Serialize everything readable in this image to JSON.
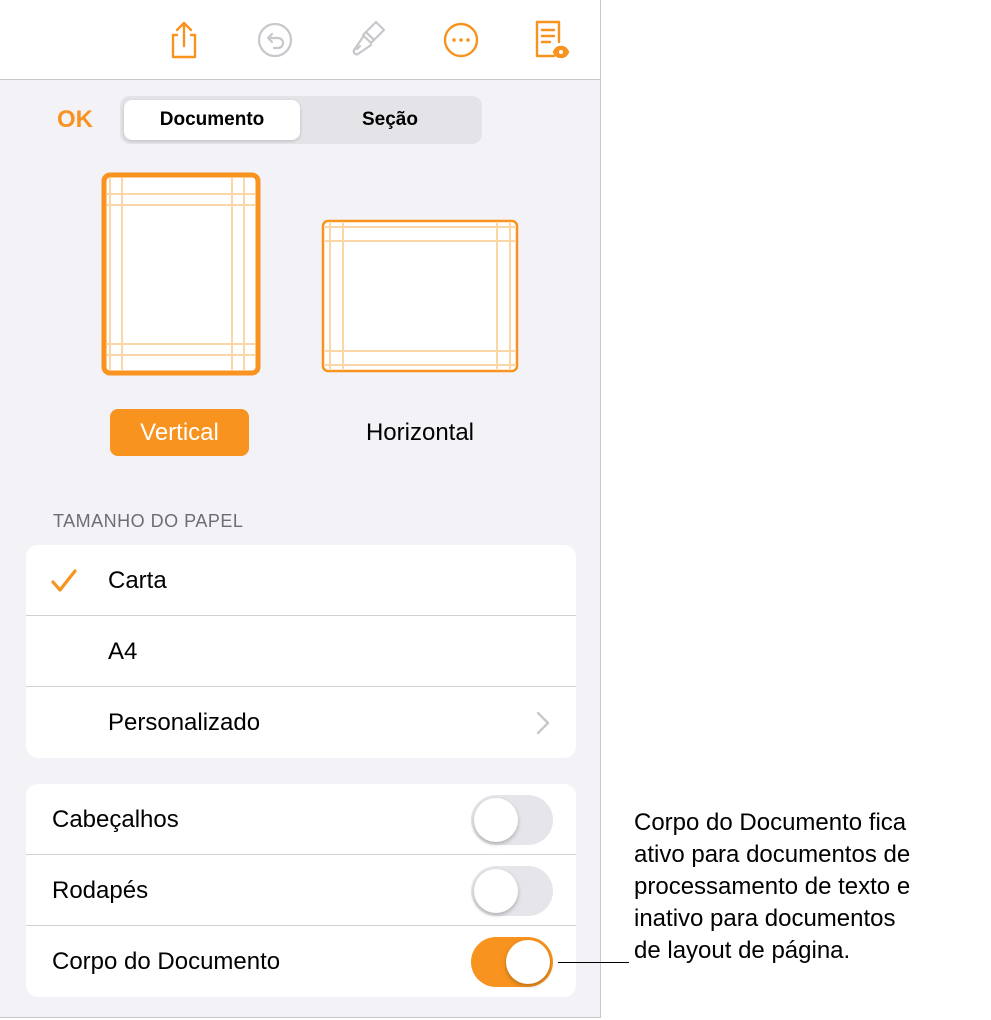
{
  "toolbar": {
    "icons": [
      "share-icon",
      "undo-icon",
      "paintbrush-icon",
      "more-icon",
      "document-setup-icon"
    ],
    "accent": "#f7931e"
  },
  "header": {
    "ok_label": "OK",
    "tabs": [
      {
        "label": "Documento",
        "selected": true
      },
      {
        "label": "Seção",
        "selected": false
      }
    ]
  },
  "orientation": {
    "options": [
      {
        "label": "Vertical",
        "selected": true
      },
      {
        "label": "Horizontal",
        "selected": false
      }
    ]
  },
  "paper_size": {
    "heading": "TAMANHO DO PAPEL",
    "items": [
      {
        "label": "Carta",
        "checked": true
      },
      {
        "label": "A4",
        "checked": false
      },
      {
        "label": "Personalizado",
        "checked": false,
        "has_chevron": true
      }
    ]
  },
  "toggles": {
    "items": [
      {
        "label": "Cabeçalhos",
        "on": false
      },
      {
        "label": "Rodapés",
        "on": false
      },
      {
        "label": "Corpo do Documento",
        "on": true
      }
    ]
  },
  "callout": {
    "lines": [
      "Corpo do Documento fica",
      "ativo para documentos de",
      "processamento de texto e",
      "inativo para documentos",
      "de layout de página."
    ]
  }
}
